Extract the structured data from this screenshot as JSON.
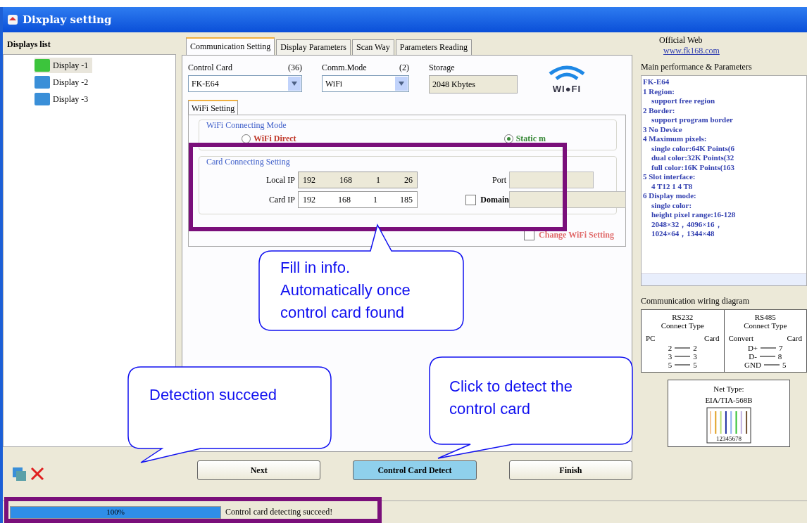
{
  "window": {
    "title": "Dixplay setting"
  },
  "displays_list": {
    "title": "Displays list",
    "items": [
      {
        "label": "Display -1",
        "selected": true
      },
      {
        "label": "Display -2",
        "selected": false
      },
      {
        "label": "Display -3",
        "selected": false
      }
    ]
  },
  "tabs": [
    {
      "label": "Communication Setting",
      "selected": true
    },
    {
      "label": "Display Parameters",
      "selected": false
    },
    {
      "label": "Scan Way",
      "selected": false
    },
    {
      "label": "Parameters Reading",
      "selected": false
    }
  ],
  "control_card": {
    "label": "Control Card",
    "count": "(36)",
    "value": "FK-E64"
  },
  "comm_mode": {
    "label": "Comm.Mode",
    "count": "(2)",
    "value": "WiFi"
  },
  "storage": {
    "label": "Storage",
    "value": "2048 Kbytes"
  },
  "wifi_logo": {
    "text": "WI●FI"
  },
  "subtabs": [
    {
      "label": "WiFi Setting",
      "selected": true
    }
  ],
  "wifi_mode": {
    "title": "WiFi Connecting Mode",
    "options": [
      {
        "label": "WiFi Direct",
        "selected": false
      },
      {
        "label": "Static m",
        "selected": true
      }
    ]
  },
  "card_setting": {
    "title": "Card Connecting Setting",
    "ips": [
      {
        "label": "Local IP",
        "octets": [
          "192",
          "168",
          "1",
          "26"
        ],
        "disabled": true
      },
      {
        "label": "Card IP",
        "octets": [
          "192",
          "168",
          "1",
          "185"
        ],
        "disabled": false
      }
    ],
    "port": {
      "label": "Port"
    },
    "domain": {
      "label": "Domain",
      "checked": false
    }
  },
  "change_wifi": {
    "label": "Change WiFi Setting",
    "checked": false
  },
  "buttons": [
    {
      "label": "Next",
      "kind": "normal"
    },
    {
      "label": "Control Card Detect",
      "kind": "highlighted"
    },
    {
      "label": "Finish",
      "kind": "normal"
    }
  ],
  "official_web": {
    "label": "Official Web",
    "link": "www.fk168.com"
  },
  "performance": {
    "title": "Main performance & Parameters",
    "lines": [
      {
        "text": "FK-E64",
        "kind": "heading"
      },
      {
        "text": "1 Region:",
        "kind": "heading"
      },
      {
        "text": "support free region",
        "kind": "detail"
      },
      {
        "text": "2 Border:",
        "kind": "heading"
      },
      {
        "text": "support program border",
        "kind": "detail"
      },
      {
        "text": "3 No Device",
        "kind": "heading"
      },
      {
        "text": "4 Maximum pixels:",
        "kind": "heading"
      },
      {
        "text": "single color:64K Points(6",
        "kind": "detail"
      },
      {
        "text": "dual color:32K Points(32",
        "kind": "detail"
      },
      {
        "text": "full color:16K Points(163",
        "kind": "detail"
      },
      {
        "text": "5 Slot interface:",
        "kind": "heading"
      },
      {
        "text": "4 T12 1 4 T8",
        "kind": "detail"
      },
      {
        "text": "6 Display mode:",
        "kind": "heading"
      },
      {
        "text": "single color:",
        "kind": "detail"
      },
      {
        "text": "height pixel range:16-128",
        "kind": "detail"
      },
      {
        "text": "2048×32，4096×16，",
        "kind": "detail"
      },
      {
        "text": "1024×64，1344×48",
        "kind": "detail"
      }
    ]
  },
  "wiring": {
    "title": "Communication wiring diagram",
    "tables": [
      {
        "title": "RS232",
        "subtitle": "Connect Type",
        "left": "PC",
        "right": "Card",
        "rows": [
          [
            "2",
            "2"
          ],
          [
            "3",
            "3"
          ],
          [
            "5",
            "5"
          ]
        ]
      },
      {
        "title": "RS485",
        "subtitle": "Connect Type",
        "left": "Convert",
        "right": "Card",
        "rows": [
          [
            "D+",
            "7"
          ],
          [
            "D-",
            "8"
          ],
          [
            "GND",
            "5"
          ]
        ]
      }
    ]
  },
  "net_type": {
    "title": "Net Type:",
    "standard": "EIA/TIA-568B",
    "pins": "12345678"
  },
  "status": {
    "progress": {
      "level": 1,
      "label": "100%"
    },
    "message": "Control card detecting succeed!"
  },
  "callouts": [
    {
      "lines": [
        "Fill in info.",
        "Automatically once",
        "control card found"
      ]
    },
    {
      "lines": [
        "Detection succeed"
      ]
    },
    {
      "lines": [
        "Click to detect the",
        "control card"
      ]
    }
  ]
}
